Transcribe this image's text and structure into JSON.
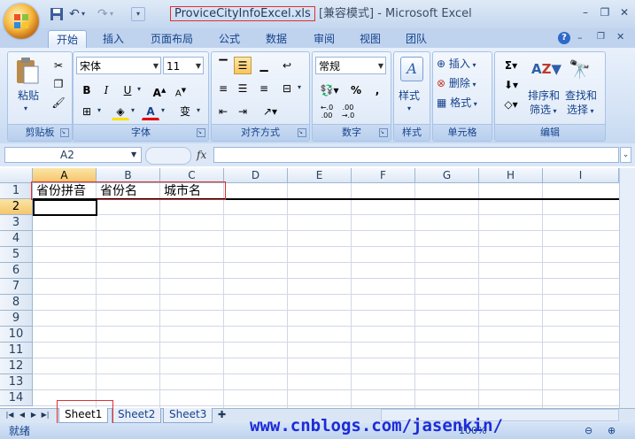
{
  "window": {
    "file_name": "ProviceCityInfoExcel.xls",
    "title_rest": " [兼容模式] - Microsoft Excel",
    "controls": [
      "–",
      "❐",
      "✕"
    ]
  },
  "ribbon_tabs": [
    "开始",
    "插入",
    "页面布局",
    "公式",
    "数据",
    "审阅",
    "视图",
    "团队"
  ],
  "ribbon": {
    "clipboard": {
      "paste": "粘贴",
      "label": "剪贴板"
    },
    "font": {
      "name": "宋体",
      "size": "11",
      "label": "字体"
    },
    "alignment": {
      "label": "对齐方式"
    },
    "number": {
      "format": "常规",
      "label": "数字"
    },
    "styles": {
      "label": "样式"
    },
    "cells": {
      "insert": "插入",
      "delete": "删除",
      "format": "格式",
      "label": "单元格"
    },
    "editing": {
      "sort": "排序和",
      "filter": "筛选",
      "find": "查找和",
      "select": "选择",
      "label": "编辑"
    }
  },
  "formula_bar": {
    "name_box": "A2",
    "fx": "fx",
    "value": ""
  },
  "grid": {
    "columns": [
      "A",
      "B",
      "C",
      "D",
      "E",
      "F",
      "G",
      "H",
      "I"
    ],
    "rows": [
      "1",
      "2",
      "3",
      "4",
      "5",
      "6",
      "7",
      "8",
      "9",
      "10",
      "11",
      "12",
      "13",
      "14"
    ],
    "row1": {
      "A": "省份拼音",
      "B": "省份名",
      "C": "城市名"
    }
  },
  "sheets": [
    "Sheet1",
    "Sheet2",
    "Sheet3"
  ],
  "status": "就绪",
  "zoom": "100%",
  "watermark": "www.cnblogs.com/jasenkin/"
}
